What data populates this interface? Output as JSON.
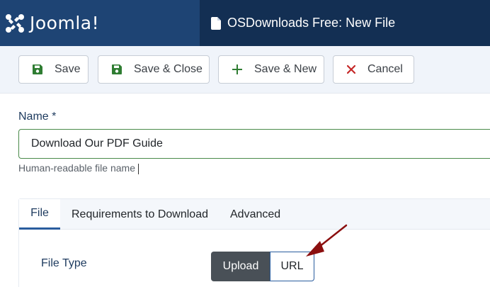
{
  "header": {
    "logo_text": "Joomla!",
    "logo_icon": "joomla-logo-icon",
    "page_title": "OSDownloads Free: New File",
    "title_icon": "file-icon"
  },
  "toolbar": {
    "save_label": "Save",
    "save_close_label": "Save & Close",
    "save_new_label": "Save & New",
    "cancel_label": "Cancel",
    "save_icon": "floppy-disk-icon",
    "new_icon": "plus-icon",
    "cancel_icon": "x-icon"
  },
  "form": {
    "name_label": "Name *",
    "name_value": "Download Our PDF Guide",
    "name_help": "Human-readable file name"
  },
  "tabs": [
    {
      "label": "File",
      "active": true
    },
    {
      "label": "Requirements to Download",
      "active": false
    },
    {
      "label": "Advanced",
      "active": false
    }
  ],
  "file_type": {
    "label": "File Type",
    "options": [
      "Upload",
      "URL"
    ],
    "selected": "Upload"
  },
  "colors": {
    "header_bg": "#132f53",
    "logo_bg": "#1e4474",
    "toolbar_bg": "#f0f4fa",
    "success_green": "#2f7d32",
    "danger_red": "#c52828",
    "annotation_arrow": "#8b0f0f"
  }
}
